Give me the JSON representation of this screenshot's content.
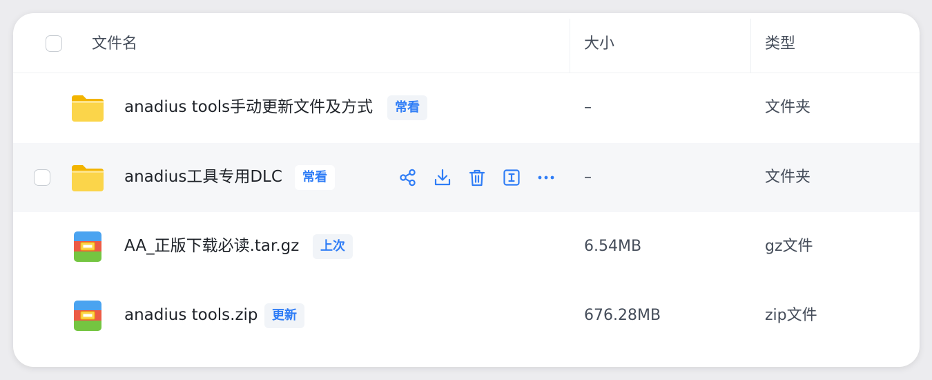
{
  "table": {
    "columns": {
      "name": "文件名",
      "size": "大小",
      "type": "类型"
    },
    "rows": [
      {
        "name": "anadius tools手动更新文件及方式",
        "tag": "常看",
        "size": "–",
        "type": "文件夹",
        "icon": "folder-icon"
      },
      {
        "name": "anadius工具专用DLC",
        "tag": "常看",
        "size": "–",
        "type": "文件夹",
        "icon": "folder-icon"
      },
      {
        "name": "AA_正版下载必读.tar.gz",
        "tag": "上次",
        "size": "6.54MB",
        "type": "gz文件",
        "icon": "archive-icon"
      },
      {
        "name": "anadius tools.zip",
        "tag": "更新",
        "size": "676.28MB",
        "type": "zip文件",
        "icon": "archive-icon"
      }
    ]
  },
  "row_actions": [
    "share-icon",
    "download-icon",
    "trash-icon",
    "rename-icon",
    "more-icon"
  ],
  "colors": {
    "accent": "#2f7df6",
    "tag_bg": "#f1f4f8",
    "hover_row": "#f6f7f9",
    "folder_yellow": "#f9cd2e",
    "archive_red": "#ec5b45",
    "archive_green": "#74c541",
    "archive_blue": "#4aa3f0"
  }
}
